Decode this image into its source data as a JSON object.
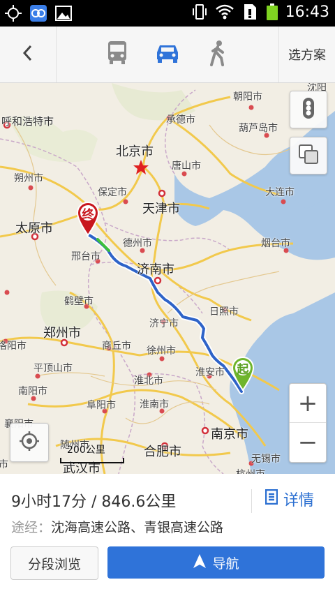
{
  "status_bar": {
    "time": "16:43",
    "icons": [
      "gps-icon",
      "app-icon",
      "image-icon",
      "vibrate-icon",
      "wifi-icon",
      "sim-icon",
      "battery-icon"
    ]
  },
  "topbar": {
    "modes": [
      {
        "name": "bus",
        "active": false
      },
      {
        "name": "car",
        "active": true
      },
      {
        "name": "walk",
        "active": false
      }
    ],
    "options_label": "选方案"
  },
  "colors": {
    "accent": "#2f73d9",
    "route": "#2e63c8",
    "sea": "#a9c7e6",
    "start_marker": "#6fb52c",
    "end_marker": "#c8171e"
  },
  "map": {
    "labels": {
      "beijing": "北京市",
      "tianjin": "天津市",
      "jinan": "济南市",
      "zhengzhou": "郑州市",
      "taiyuan": "太原市",
      "nanjing": "南京市",
      "hefei": "合肥市",
      "wuhan": "武汉市",
      "huhehaote": "呼和浩特市",
      "chengde": "承德市",
      "chaoyang": "朝阳市",
      "shenyang": "沈阳",
      "huludao": "葫芦岛市",
      "tangshan": "唐山市",
      "dalian": "大连市",
      "baoding": "保定市",
      "shuozhou": "朔州市",
      "dezhou": "德州市",
      "yantai": "烟台市",
      "xingtai": "邢台市",
      "hebi": "鹤壁市",
      "rizhao": "日照市",
      "jining": "济宁市",
      "shangqiu": "商丘市",
      "xuzhou": "徐州市",
      "huaian": "淮安市",
      "pingdingshan": "平顶山市",
      "huaibei": "淮北市",
      "nanyang": "南阳市",
      "fuyang": "阜阳市",
      "huainan": "淮南市",
      "wuxi": "无锡市",
      "luoyang": "洛阳市",
      "suizhou": "随州市",
      "xiangyang": "襄阳市",
      "jingmen": "荆门市",
      "hangzhou": "杭州市"
    },
    "start_marker_text": "起",
    "end_marker_text": "终",
    "scale_text": "200公里"
  },
  "controls": {
    "compass_icon": "traffic-icon",
    "layers_icon": "layers-icon",
    "locate_icon": "locate-icon",
    "zoom_in": "+",
    "zoom_out": "−"
  },
  "route_panel": {
    "summary": "9小时17分 / 846.6公里",
    "details_label": "详情",
    "via_label": "途经：",
    "via_roads": "沈海高速公路、青银高速公路",
    "segment_button": "分段浏览",
    "navigate_button": "导航"
  }
}
